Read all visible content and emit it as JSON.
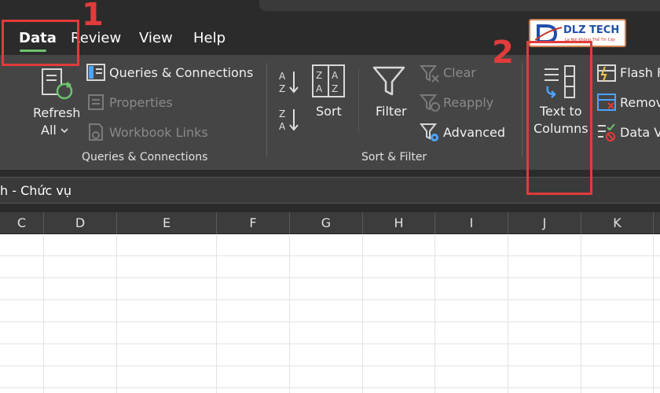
{
  "tabs": [
    {
      "label": "Data",
      "active": true
    },
    {
      "label": "Review"
    },
    {
      "label": "View"
    },
    {
      "label": "Help"
    }
  ],
  "ribbon": {
    "refresh": {
      "label1": "Refresh",
      "label2": "All"
    },
    "queries": {
      "items": [
        "Queries & Connections",
        "Properties",
        "Workbook Links"
      ],
      "group_label": "Queries & Connections"
    },
    "sort_filter": {
      "sort_label": "Sort",
      "filter_label": "Filter",
      "clear_label": "Clear",
      "reapply_label": "Reapply",
      "advanced_label": "Advanced",
      "group_label": "Sort & Filter"
    },
    "data_tools": {
      "text_to_columns_line1": "Text to",
      "text_to_columns_line2": "Columns",
      "flash_fill": "Flash F",
      "remove_duplicates": "Remov",
      "data_validation": "Data V"
    }
  },
  "formula_bar": {
    "text": "h - Chức vụ"
  },
  "columns": [
    "C",
    "D",
    "E",
    "F",
    "G",
    "H",
    "I",
    "J",
    "K"
  ],
  "annotations": {
    "step1": "1",
    "step2": "2"
  },
  "logo": {
    "text": "DLZ TECH",
    "sub": "Là Nơi Không Thể Tin Cậy"
  },
  "colors": {
    "accent": "#6cc46c",
    "annotation": "#e23b3b",
    "icon_blue": "#4da3ff"
  }
}
